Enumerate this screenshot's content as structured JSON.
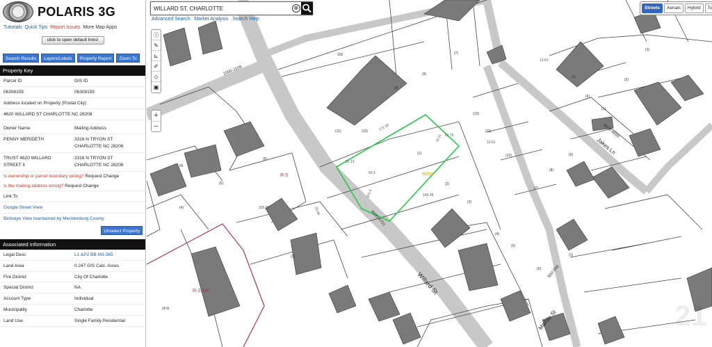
{
  "app": {
    "title": "POLARIS 3G"
  },
  "top_links": [
    "Tutorials",
    "Quick Tips",
    "Report Issues",
    "More Map Apps"
  ],
  "default_links_button": "click to open default links!",
  "action_buttons": [
    "Search Results",
    "Layers/Labels",
    "Property Report",
    "Zoom To"
  ],
  "property_key": {
    "heading": "Property Key",
    "parcel_label": "Parcel ID",
    "gis_label": "GIS ID",
    "parcel_value": "06308159",
    "gis_value": "06308159",
    "address_label": "Address located on Property (Postal City)",
    "address_value": "4620 WILLARD ST CHARLOTTE NC 28208",
    "owner_label": "Owner Name",
    "mailing_label": "Mailing Address",
    "owner1": "PENNY MERIDETH",
    "mail1_a": "3316 N TRYON ST",
    "mail1_b": "CHARLOTTE NC 28206",
    "owner2_a": "TRUST 4620 WILLARD",
    "owner2_b": "STREET II",
    "mail2_a": "3316 N TRYON ST",
    "mail2_b": "CHARLOTTE NC 28206",
    "ownership_link": "Is ownership or parcel boundary wrong?",
    "ownership_action": "Request Change",
    "mailing_link": "Is the mailing address wrong?",
    "mailing_action": "Request Change",
    "link_to": "Link To",
    "street_view": "Google Street View",
    "birdseye": "Birdseye View maintained by Mecklenburg County",
    "unselect": "Unselect Property"
  },
  "associated": {
    "heading": "Associated Information",
    "rows": [
      {
        "k": "Legal Desc",
        "v": "L1 &P2 BB M3-365",
        "link": true
      },
      {
        "k": "Land Area",
        "v": "0.247 GIS Calc. Acres",
        "link": false
      },
      {
        "k": "Fire District",
        "v": "City Of Charlotte",
        "link": false
      },
      {
        "k": "Special District",
        "v": "NA",
        "link": false
      },
      {
        "k": "Account Type",
        "v": "Individual",
        "link": false
      },
      {
        "k": "Municipality",
        "v": "Charlotte",
        "link": false
      },
      {
        "k": "Land Use",
        "v": "Single Family Residential",
        "link": false
      }
    ]
  },
  "search": {
    "value": "WILLARD ST, CHARLOTTE",
    "clear": "⊗",
    "links": [
      "Advanced Search",
      "Market Analysis",
      "Search Help"
    ]
  },
  "basemaps": [
    "Streets",
    "Aerials",
    "Hybrid",
    "Topo"
  ],
  "map_labels": {
    "willard": "Willard St",
    "jakes": "Jakes Ln",
    "marble": "Marble St",
    "range1": "1000-1109",
    "range2": "4600-4701",
    "range3": "4600-4699",
    "range4": "900-999",
    "zone1": "R-5",
    "zone2": "R-22MF",
    "parcel_tag": "06308",
    "year": "21"
  },
  "colors": {
    "selected_parcel": "#22cc44",
    "zoning": "#b03060",
    "accent": "#2f66c4"
  }
}
